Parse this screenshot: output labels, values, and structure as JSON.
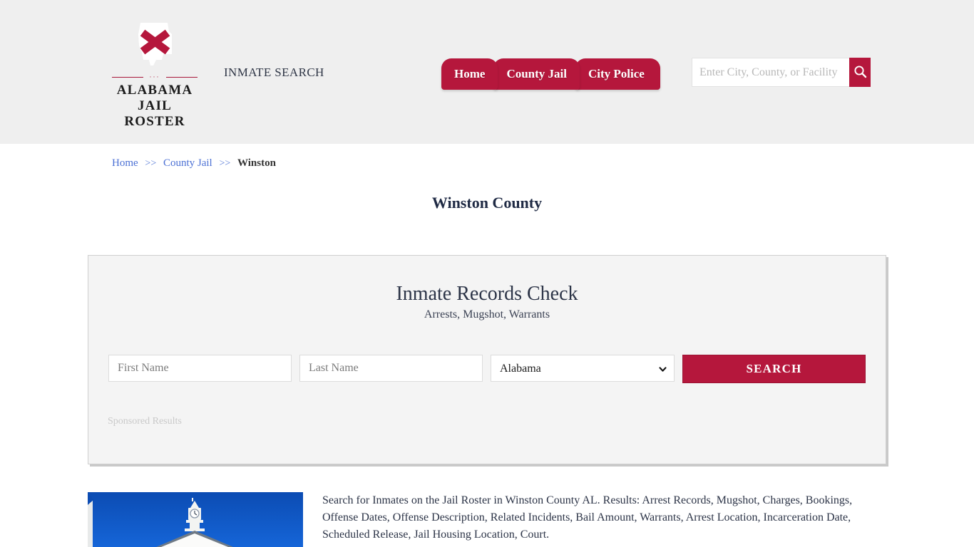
{
  "header": {
    "brand": {
      "line1": "ALABAMA",
      "line2": "JAIL ROSTER",
      "dots": "···",
      "logo_icon": "alabama-state-flag-icon",
      "white": "#ffffff",
      "cross": "#b5173c"
    },
    "tagline": "INMATE SEARCH",
    "nav": [
      {
        "label": "Home"
      },
      {
        "label": "County Jail"
      },
      {
        "label": "City Police"
      }
    ],
    "search": {
      "placeholder": "Enter City, County, or Facility",
      "value": "",
      "button_icon": "search-icon"
    },
    "accent": "#b5173c",
    "band_bg": "#efefef"
  },
  "breadcrumb": {
    "items": [
      {
        "label": "Home",
        "current": false
      },
      {
        "label": "County Jail",
        "current": false
      },
      {
        "label": "Winston",
        "current": true
      }
    ],
    "separator": ">>",
    "link_color": "#4a6fd4"
  },
  "page": {
    "title": "Winston County"
  },
  "card": {
    "title": "Inmate Records Check",
    "subtitle": "Arrests, Mugshot, Warrants",
    "form": {
      "first_name_placeholder": "First Name",
      "first_name_value": "",
      "last_name_placeholder": "Last Name",
      "last_name_value": "",
      "state_selected": "Alabama",
      "state_options": [
        "Alabama"
      ],
      "state_chevron_icon": "chevron-down-icon",
      "search_label": "SEARCH"
    },
    "sponsored_label": "Sponsored Results"
  },
  "bottom": {
    "image_alt": "winston-county-courthouse-photo",
    "description": "Search for Inmates on the Jail Roster in Winston County AL. Results: Arrest Records, Mugshot, Charges, Bookings, Offense Dates, Offense Description, Related Incidents, Bail Amount, Warrants, Arrest Location, Incarceration Date, Scheduled Release, Jail Housing Location, Court."
  }
}
